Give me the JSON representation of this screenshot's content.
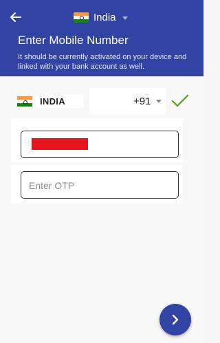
{
  "header": {
    "country": "India",
    "title": "Enter Mobile Number",
    "subtitle": "It should be currently activated on your device and linked with your bank account as well."
  },
  "country_row": {
    "country": "INDIA",
    "dial_code": "+91"
  },
  "phone_field": {
    "value": ""
  },
  "otp_field": {
    "placeholder": "Enter OTP"
  },
  "icons": {
    "back": "back-arrow-icon",
    "check": "check-icon",
    "next": "chevron-right-icon",
    "flag": "india-flag-icon"
  },
  "colors": {
    "primary": "#3143a3",
    "check": "#6aa52e",
    "redaction": "#e8141c"
  }
}
